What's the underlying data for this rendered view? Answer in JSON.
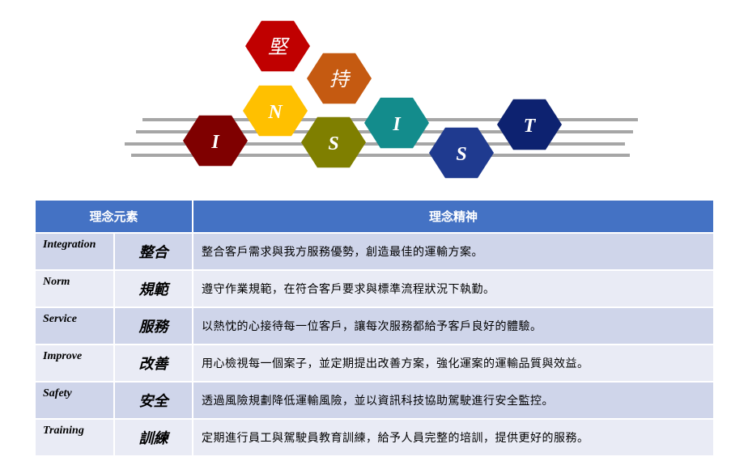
{
  "hexagons": [
    {
      "label": "堅",
      "color": "#c00000"
    },
    {
      "label": "持",
      "color": "#c55a11"
    },
    {
      "label": "N",
      "color": "#ffc000"
    },
    {
      "label": "I",
      "color": "#7f0000"
    },
    {
      "label": "S",
      "color": "#7f7f00"
    },
    {
      "label": "I",
      "color": "#138c8c"
    },
    {
      "label": "S",
      "color": "#1f3a8f"
    },
    {
      "label": "T",
      "color": "#0d2270"
    }
  ],
  "table": {
    "header_element": "理念元素",
    "header_spirit": "理念精神",
    "rows": [
      {
        "en": "Integration",
        "zh": "整合",
        "desc": "整合客戶需求與我方服務優勢，創造最佳的運輸方案。"
      },
      {
        "en": "Norm",
        "zh": "規範",
        "desc": "遵守作業規範，在符合客戶要求與標準流程狀況下執勤。"
      },
      {
        "en": "Service",
        "zh": "服務",
        "desc": "以熱忱的心接待每一位客戶，讓每次服務都給予客戶良好的體驗。"
      },
      {
        "en": "Improve",
        "zh": "改善",
        "desc": "用心檢視每一個案子，並定期提出改善方案，強化運案的運輸品質與效益。"
      },
      {
        "en": "Safety",
        "zh": "安全",
        "desc": "透過風險規劃降低運輸風險，並以資訊科技協助駕駛進行安全監控。"
      },
      {
        "en": "Training",
        "zh": "訓練",
        "desc": "定期進行員工與駕駛員教育訓練，給予人員完整的培訓，提供更好的服務。"
      }
    ]
  }
}
